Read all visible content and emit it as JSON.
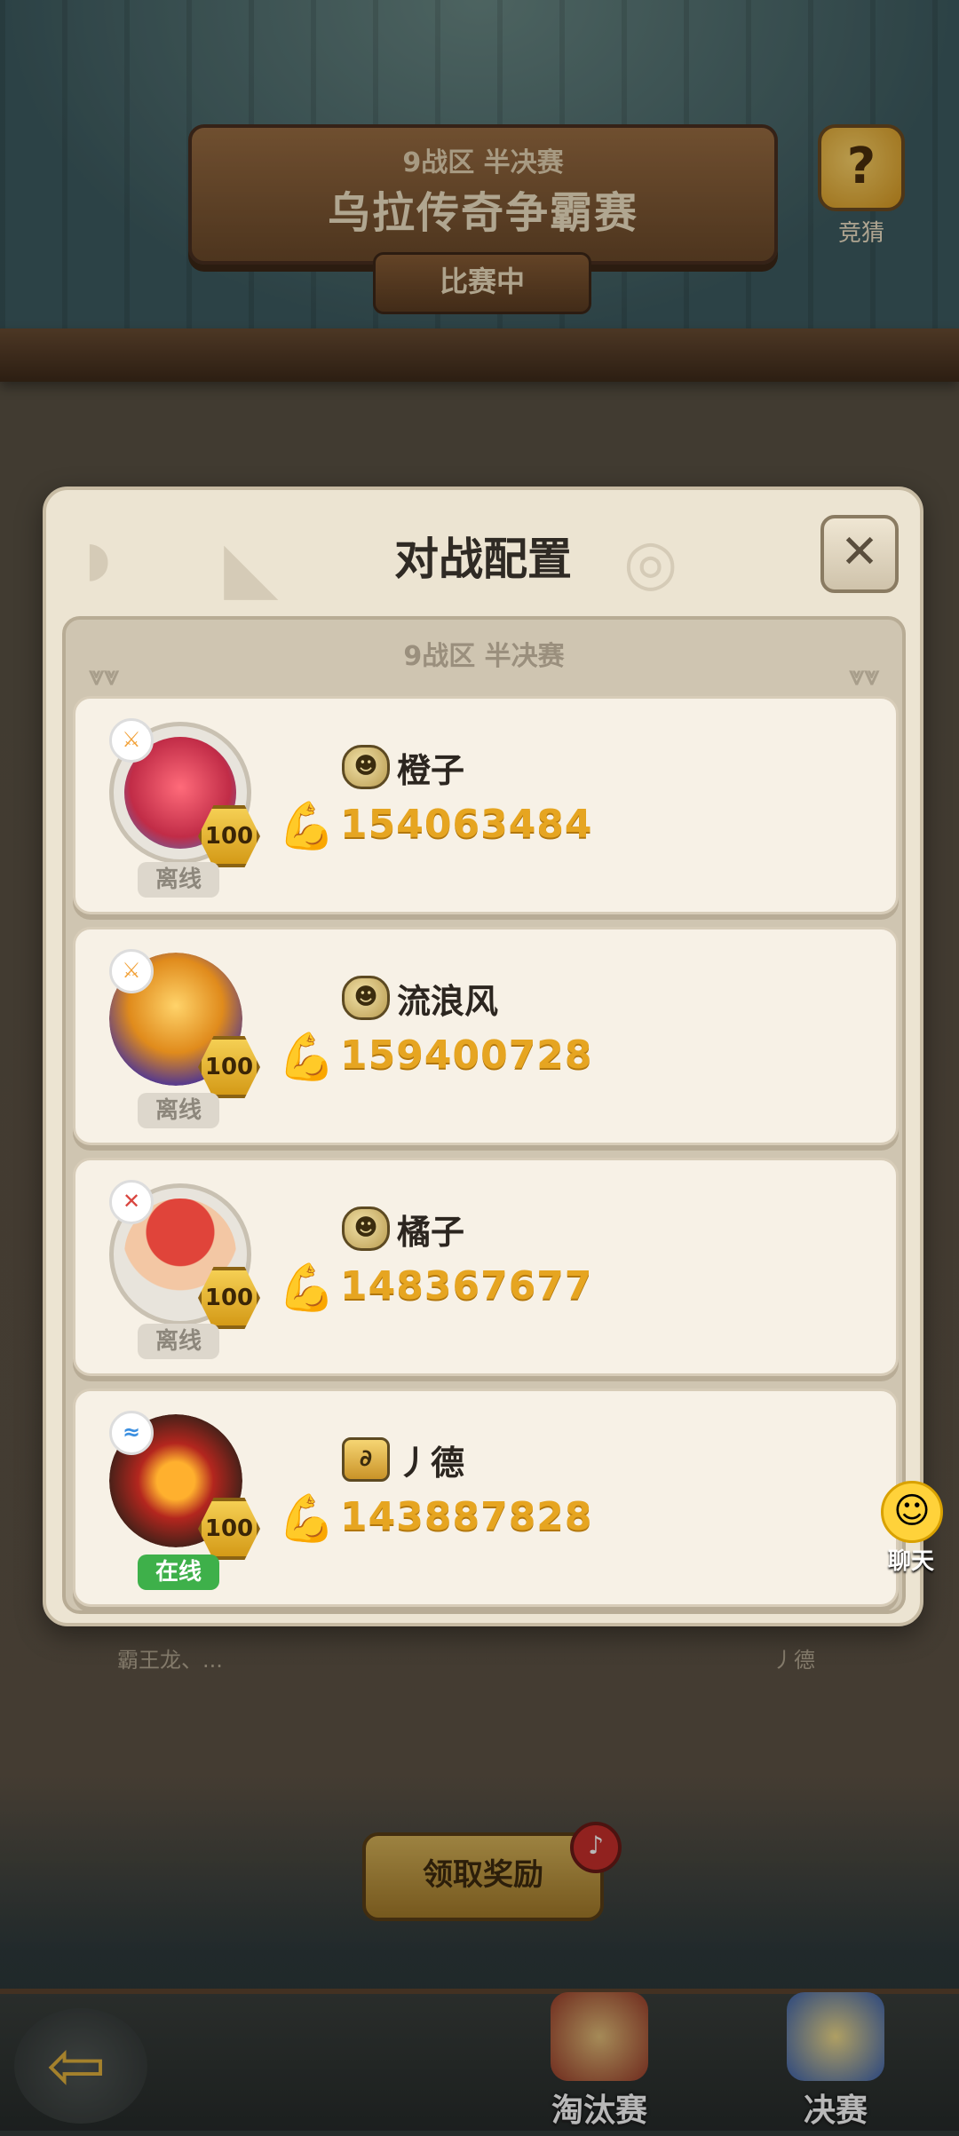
{
  "header": {
    "subtitle": "9战区 半决赛",
    "title": "乌拉传奇争霸赛",
    "status": "比赛中",
    "guess_label": "竞猜",
    "guess_icon": "?"
  },
  "background": {
    "left_team_names": "霸王龙、...",
    "right_team_names": "丿德",
    "claim_reward_label": "领取奖励",
    "claim_badge_icon": "bell-icon",
    "tabs": [
      {
        "label": "淘汰赛",
        "icon": "crossed-swords-icon"
      },
      {
        "label": "决赛",
        "icon": "trophy-icon"
      }
    ],
    "back_icon": "back-arrow-icon"
  },
  "modal": {
    "title": "对战配置",
    "close_icon": "close-icon",
    "section_title": "9战区 半决赛",
    "players": [
      {
        "name": "橙子",
        "power": "154063484",
        "level": "100",
        "status": "离线",
        "online": false,
        "rank_icon": "rank-emblem-icon",
        "element_icon": "fire-element-icon",
        "accent": "#f2a23a"
      },
      {
        "name": "流浪风",
        "power": "159400728",
        "level": "100",
        "status": "离线",
        "online": false,
        "rank_icon": "rank-emblem-icon",
        "element_icon": "fire-element-icon",
        "accent": "#f2a23a"
      },
      {
        "name": "橘子",
        "power": "148367677",
        "level": "100",
        "status": "离线",
        "online": false,
        "rank_icon": "rank-emblem-icon",
        "element_icon": "combat-element-icon",
        "accent": "#d9453f"
      },
      {
        "name": "丿德",
        "power": "143887828",
        "level": "100",
        "status": "在线",
        "online": true,
        "rank_icon": "shield-rank-icon",
        "element_icon": "water-element-icon",
        "accent": "#3b8fe0"
      }
    ]
  },
  "chat": {
    "label": "聊天",
    "icon": "chat-face-icon"
  },
  "colors": {
    "power_gold": "#e6a521",
    "online_green": "#3eb04a",
    "offline_gray": "#ddd7cc",
    "panel_cream": "#ece4d2"
  }
}
